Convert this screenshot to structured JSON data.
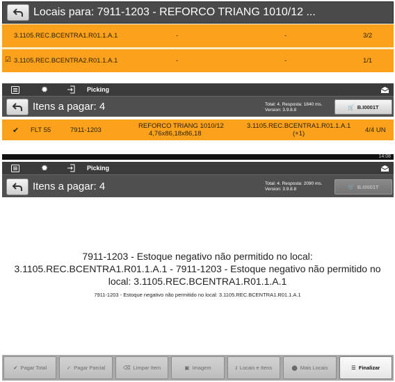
{
  "locais_panel": {
    "title": "Locais para: 7911-1203 - REFORCO TRIANG 1010/12 ...",
    "rows": [
      {
        "local": "3.1105.REC.BCENTRA1.R01.1.A.1",
        "col2": "-",
        "col3": "-",
        "qty": "3/2",
        "checked": false
      },
      {
        "local": "3.1105.REC.BCENTRA2.R01.1.A.1",
        "col2": "-",
        "col3": "-",
        "qty": "1/1",
        "checked": true
      }
    ]
  },
  "picking_top": {
    "actionbar_label": "Picking",
    "subheader_title": "Itens a pagar: 4",
    "info_line1": "Total: 4. Resposta: 1840 ms.",
    "info_line2": "Version: 3.9.8.8",
    "cart_label": "B.I0001T",
    "item": {
      "lote": "FLT 55",
      "codigo": "7911-1203",
      "descricao_l1": "REFORCO TRIANG 1010/12",
      "descricao_l2": "4,76x86,18x86,18",
      "local_l1": "3.1105.REC.BCENTRA1.R01.1.A.1",
      "local_l2": "(+1)",
      "qty": "4/4 UN"
    }
  },
  "picking_bottom": {
    "status_time": "14:08",
    "actionbar_label": "Picking",
    "subheader_title": "Itens a pagar: 4",
    "info_line1": "Total: 4. Resposta: 2090 ms.",
    "info_line2": "Version: 3.9.8.8",
    "cart_label": "B.I0001T"
  },
  "message": {
    "big_l1": "7911-1203 - Estoque negativo não permitido no local:",
    "big_l2": "3.1105.REC.BCENTRA1.R01.1.A.1 - 7911-1203 - Estoque negativo não permitido no",
    "big_l3": "local: 3.1105.REC.BCENTRA1.R01.1.A.1",
    "small": "7911-1203 - Estoque negativo não permitido no local: 3.1105.REC.BCENTRA1.R01.1.A.1"
  },
  "toolbar": {
    "pagar_total": "Pagar Total",
    "pagar_parcial": "Pagar Parcial",
    "limpar_item": "Limpar Item",
    "imagem": "Imagem",
    "locais_itens": "Locais e Itens",
    "mais_locais": "Mais Locais",
    "finalizar": "Finalizar"
  },
  "colors": {
    "accent_orange": "#fba11b",
    "header_dark": "#4a4a4a",
    "actionbar": "#3b3b3b"
  }
}
